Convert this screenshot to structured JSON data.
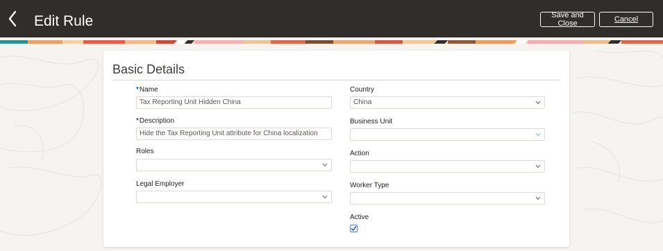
{
  "header": {
    "title": "Edit Rule",
    "save_label": "Save and Close",
    "cancel_label": "Cancel",
    "background": "#312d2a"
  },
  "section": {
    "title": "Basic Details"
  },
  "form": {
    "name": {
      "label": "Name",
      "required_mark": "*",
      "value": "Tax Reporting Unit Hidden China"
    },
    "description": {
      "label": "Description",
      "required_mark": "*",
      "value": "Hide the Tax Reporting Unit attribute for China localization"
    },
    "roles": {
      "label": "Roles",
      "value": ""
    },
    "legal_employer": {
      "label": "Legal Employer",
      "value": ""
    },
    "country": {
      "label": "Country",
      "value": "China"
    },
    "business_unit": {
      "label": "Business Unit",
      "value": ""
    },
    "action": {
      "label": "Action",
      "value": ""
    },
    "worker_type": {
      "label": "Worker Type",
      "value": ""
    },
    "active": {
      "label": "Active",
      "checked": true
    }
  },
  "colors": {
    "accent": "#1f56a5",
    "page_bg": "#f6f4f1"
  },
  "icons": {
    "back": "chevron-left-icon",
    "dropdown": "chevron-down-icon",
    "check": "checkmark-icon"
  }
}
